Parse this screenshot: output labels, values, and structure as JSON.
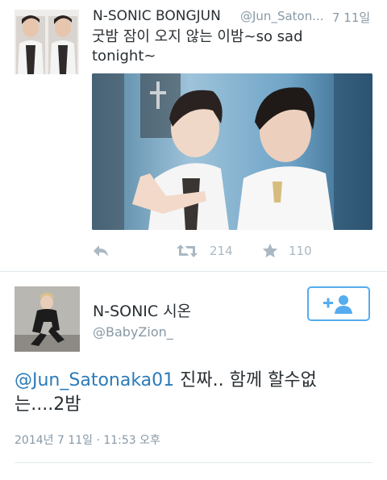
{
  "tweet1": {
    "name": "N-SONIC BONGJUN",
    "handle": "@Jun_Saton...",
    "date": "7 11일",
    "text": "굿밤 잠이 오지 않는 이밤~so sad tonight~",
    "actions": {
      "reply_icon": "reply-icon",
      "retweet_icon": "retweet-icon",
      "retweet_count": "214",
      "favorite_icon": "star-icon",
      "favorite_count": "110"
    }
  },
  "tweet2": {
    "name": "N-SONIC 시온",
    "handle": "@BabyZion_",
    "follow_icon": "add-user-icon",
    "mention": "@Jun_Satonaka01",
    "text": " 진짜.. 함께 할수없는....2밤",
    "meta": "2014년 7 11일 · 11:53 오후"
  },
  "colors": {
    "text": "#292f33",
    "muted": "#8899a6",
    "link": "#2b7bb9",
    "accent": "#55acee",
    "action": "#aab8c2",
    "divider": "#e1e8ed"
  }
}
